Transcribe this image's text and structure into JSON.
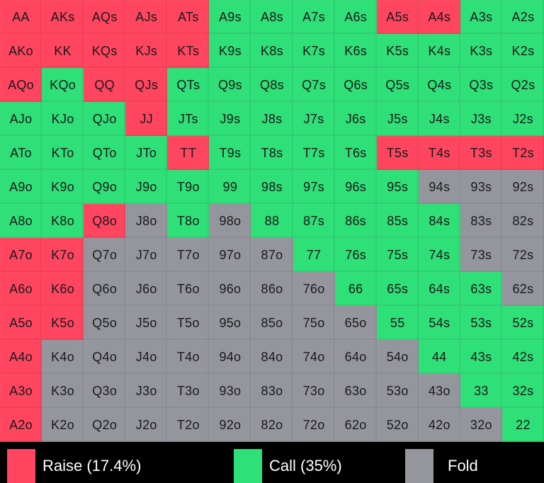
{
  "colors": {
    "raise": "#ff4560",
    "call": "#2fdf77",
    "fold": "#95969d",
    "background": "#000000",
    "legend_text": "#ffffff"
  },
  "legend": [
    {
      "action": "raise",
      "label": "Raise (17.4%)"
    },
    {
      "action": "call",
      "label": "Call (35%)"
    },
    {
      "action": "fold",
      "label": "Fold"
    }
  ],
  "grid": {
    "rows": [
      [
        [
          "AA",
          "raise"
        ],
        [
          "AKs",
          "raise"
        ],
        [
          "AQs",
          "raise"
        ],
        [
          "AJs",
          "raise"
        ],
        [
          "ATs",
          "raise"
        ],
        [
          "A9s",
          "call"
        ],
        [
          "A8s",
          "call"
        ],
        [
          "A7s",
          "call"
        ],
        [
          "A6s",
          "call"
        ],
        [
          "A5s",
          "raise"
        ],
        [
          "A4s",
          "raise"
        ],
        [
          "A3s",
          "call"
        ],
        [
          "A2s",
          "call"
        ]
      ],
      [
        [
          "AKo",
          "raise"
        ],
        [
          "KK",
          "raise"
        ],
        [
          "KQs",
          "raise"
        ],
        [
          "KJs",
          "raise"
        ],
        [
          "KTs",
          "raise"
        ],
        [
          "K9s",
          "call"
        ],
        [
          "K8s",
          "call"
        ],
        [
          "K7s",
          "call"
        ],
        [
          "K6s",
          "call"
        ],
        [
          "K5s",
          "call"
        ],
        [
          "K4s",
          "call"
        ],
        [
          "K3s",
          "call"
        ],
        [
          "K2s",
          "call"
        ]
      ],
      [
        [
          "AQo",
          "raise"
        ],
        [
          "KQo",
          "call"
        ],
        [
          "QQ",
          "raise"
        ],
        [
          "QJs",
          "raise"
        ],
        [
          "QTs",
          "call"
        ],
        [
          "Q9s",
          "call"
        ],
        [
          "Q8s",
          "call"
        ],
        [
          "Q7s",
          "call"
        ],
        [
          "Q6s",
          "call"
        ],
        [
          "Q5s",
          "call"
        ],
        [
          "Q4s",
          "call"
        ],
        [
          "Q3s",
          "call"
        ],
        [
          "Q2s",
          "call"
        ]
      ],
      [
        [
          "AJo",
          "call"
        ],
        [
          "KJo",
          "call"
        ],
        [
          "QJo",
          "call"
        ],
        [
          "JJ",
          "raise"
        ],
        [
          "JTs",
          "call"
        ],
        [
          "J9s",
          "call"
        ],
        [
          "J8s",
          "call"
        ],
        [
          "J7s",
          "call"
        ],
        [
          "J6s",
          "call"
        ],
        [
          "J5s",
          "call"
        ],
        [
          "J4s",
          "call"
        ],
        [
          "J3s",
          "call"
        ],
        [
          "J2s",
          "call"
        ]
      ],
      [
        [
          "ATo",
          "call"
        ],
        [
          "KTo",
          "call"
        ],
        [
          "QTo",
          "call"
        ],
        [
          "JTo",
          "call"
        ],
        [
          "TT",
          "raise"
        ],
        [
          "T9s",
          "call"
        ],
        [
          "T8s",
          "call"
        ],
        [
          "T7s",
          "call"
        ],
        [
          "T6s",
          "call"
        ],
        [
          "T5s",
          "raise"
        ],
        [
          "T4s",
          "raise"
        ],
        [
          "T3s",
          "raise"
        ],
        [
          "T2s",
          "raise"
        ]
      ],
      [
        [
          "A9o",
          "call"
        ],
        [
          "K9o",
          "call"
        ],
        [
          "Q9o",
          "call"
        ],
        [
          "J9o",
          "call"
        ],
        [
          "T9o",
          "call"
        ],
        [
          "99",
          "call"
        ],
        [
          "98s",
          "call"
        ],
        [
          "97s",
          "call"
        ],
        [
          "96s",
          "call"
        ],
        [
          "95s",
          "call"
        ],
        [
          "94s",
          "fold"
        ],
        [
          "93s",
          "fold"
        ],
        [
          "92s",
          "fold"
        ]
      ],
      [
        [
          "A8o",
          "call"
        ],
        [
          "K8o",
          "call"
        ],
        [
          "Q8o",
          "raise"
        ],
        [
          "J8o",
          "fold"
        ],
        [
          "T8o",
          "call"
        ],
        [
          "98o",
          "fold"
        ],
        [
          "88",
          "call"
        ],
        [
          "87s",
          "call"
        ],
        [
          "86s",
          "call"
        ],
        [
          "85s",
          "call"
        ],
        [
          "84s",
          "call"
        ],
        [
          "83s",
          "fold"
        ],
        [
          "82s",
          "fold"
        ]
      ],
      [
        [
          "A7o",
          "raise"
        ],
        [
          "K7o",
          "raise"
        ],
        [
          "Q7o",
          "fold"
        ],
        [
          "J7o",
          "fold"
        ],
        [
          "T7o",
          "fold"
        ],
        [
          "97o",
          "fold"
        ],
        [
          "87o",
          "fold"
        ],
        [
          "77",
          "call"
        ],
        [
          "76s",
          "call"
        ],
        [
          "75s",
          "call"
        ],
        [
          "74s",
          "call"
        ],
        [
          "73s",
          "fold"
        ],
        [
          "72s",
          "fold"
        ]
      ],
      [
        [
          "A6o",
          "raise"
        ],
        [
          "K6o",
          "raise"
        ],
        [
          "Q6o",
          "fold"
        ],
        [
          "J6o",
          "fold"
        ],
        [
          "T6o",
          "fold"
        ],
        [
          "96o",
          "fold"
        ],
        [
          "86o",
          "fold"
        ],
        [
          "76o",
          "fold"
        ],
        [
          "66",
          "call"
        ],
        [
          "65s",
          "call"
        ],
        [
          "64s",
          "call"
        ],
        [
          "63s",
          "call"
        ],
        [
          "62s",
          "fold"
        ]
      ],
      [
        [
          "A5o",
          "raise"
        ],
        [
          "K5o",
          "raise"
        ],
        [
          "Q5o",
          "fold"
        ],
        [
          "J5o",
          "fold"
        ],
        [
          "T5o",
          "fold"
        ],
        [
          "95o",
          "fold"
        ],
        [
          "85o",
          "fold"
        ],
        [
          "75o",
          "fold"
        ],
        [
          "65o",
          "fold"
        ],
        [
          "55",
          "call"
        ],
        [
          "54s",
          "call"
        ],
        [
          "53s",
          "call"
        ],
        [
          "52s",
          "call"
        ]
      ],
      [
        [
          "A4o",
          "raise"
        ],
        [
          "K4o",
          "fold"
        ],
        [
          "Q4o",
          "fold"
        ],
        [
          "J4o",
          "fold"
        ],
        [
          "T4o",
          "fold"
        ],
        [
          "94o",
          "fold"
        ],
        [
          "84o",
          "fold"
        ],
        [
          "74o",
          "fold"
        ],
        [
          "64o",
          "fold"
        ],
        [
          "54o",
          "fold"
        ],
        [
          "44",
          "call"
        ],
        [
          "43s",
          "call"
        ],
        [
          "42s",
          "call"
        ]
      ],
      [
        [
          "A3o",
          "raise"
        ],
        [
          "K3o",
          "fold"
        ],
        [
          "Q3o",
          "fold"
        ],
        [
          "J3o",
          "fold"
        ],
        [
          "T3o",
          "fold"
        ],
        [
          "93o",
          "fold"
        ],
        [
          "83o",
          "fold"
        ],
        [
          "73o",
          "fold"
        ],
        [
          "63o",
          "fold"
        ],
        [
          "53o",
          "fold"
        ],
        [
          "43o",
          "fold"
        ],
        [
          "33",
          "call"
        ],
        [
          "32s",
          "call"
        ]
      ],
      [
        [
          "A2o",
          "raise"
        ],
        [
          "K2o",
          "fold"
        ],
        [
          "Q2o",
          "fold"
        ],
        [
          "J2o",
          "fold"
        ],
        [
          "T2o",
          "fold"
        ],
        [
          "92o",
          "fold"
        ],
        [
          "82o",
          "fold"
        ],
        [
          "72o",
          "fold"
        ],
        [
          "62o",
          "fold"
        ],
        [
          "52o",
          "fold"
        ],
        [
          "42o",
          "fold"
        ],
        [
          "32o",
          "fold"
        ],
        [
          "22",
          "call"
        ]
      ]
    ]
  }
}
